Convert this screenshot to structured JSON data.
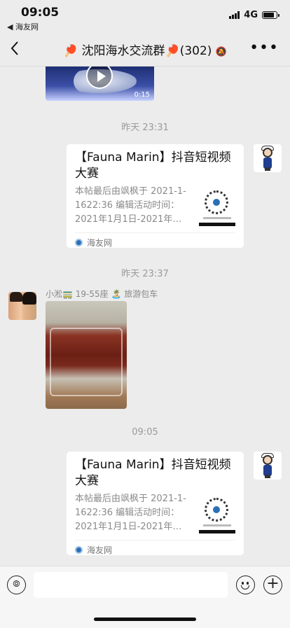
{
  "status_bar": {
    "time": "09:05",
    "back_app": "◀ 海友网",
    "network": "4G",
    "battery_level": 0.8
  },
  "nav": {
    "back_icon": "chevron-left-icon",
    "title": "🏓 沈阳海水交流群🏓(302)",
    "mute_icon": "bell-off-icon",
    "more_icon": "ellipsis-icon"
  },
  "messages": {
    "video": {
      "duration": "0:15"
    },
    "ts1": "昨天 23:31",
    "card1": {
      "title": "【Fauna Marin】抖音短视频大赛",
      "desc": "本帖最后由飒枫于 2021-1-1622:36 编辑活动时间：2021年1月1日-2021年…",
      "source": "海友网"
    },
    "ts2": "昨天 23:37",
    "photo_msg": {
      "sender": "小淞🚃 19-55座 🏝️ 旅游包车"
    },
    "ts3": "09:05",
    "card2": {
      "title": "【Fauna Marin】抖音短视频大赛",
      "desc": "本帖最后由飒枫于 2021-1-1622:36 编辑活动时间：2021年1月1日-2021年…",
      "source": "海友网"
    }
  },
  "input_bar": {
    "voice_icon": "voice-icon",
    "placeholder": "",
    "emoji_icon": "emoji-icon",
    "plus_icon": "plus-icon"
  }
}
